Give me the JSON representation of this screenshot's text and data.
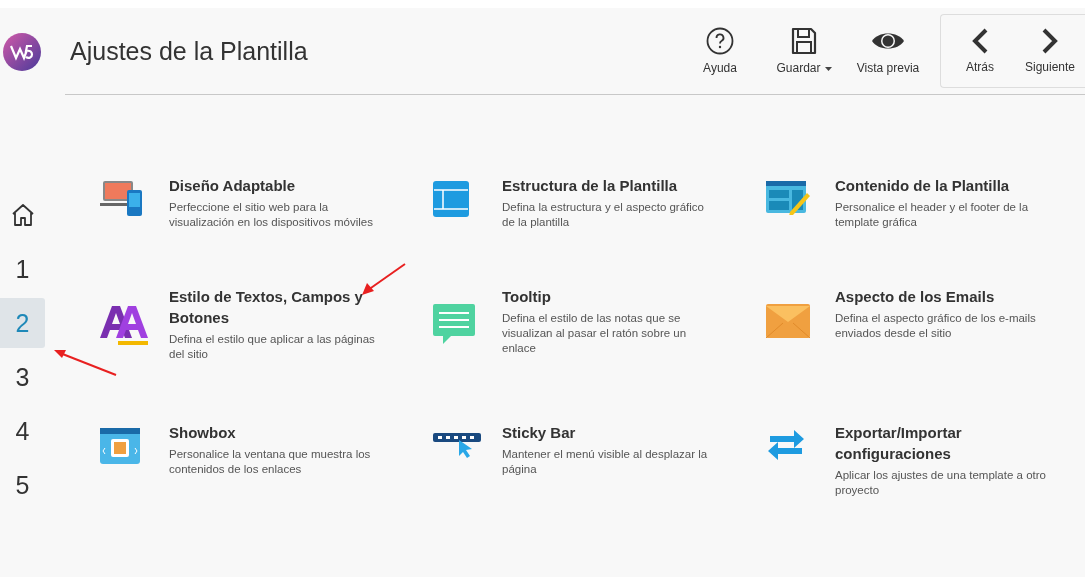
{
  "window": {
    "title": "Ajustes de la Plantilla"
  },
  "sidebar": {
    "items": [
      {
        "kind": "home",
        "selected": false
      },
      {
        "kind": "step",
        "label": "1",
        "selected": false
      },
      {
        "kind": "step",
        "label": "2",
        "selected": true
      },
      {
        "kind": "step",
        "label": "3",
        "selected": false
      },
      {
        "kind": "step",
        "label": "4",
        "selected": false
      },
      {
        "kind": "step",
        "label": "5",
        "selected": false
      }
    ]
  },
  "toolbar": {
    "buttons": [
      {
        "label": "Ayuda",
        "dropdown": false
      },
      {
        "label": "Guardar",
        "dropdown": true
      },
      {
        "label": "Vista previa",
        "dropdown": false
      }
    ],
    "nav": [
      {
        "label": "Atrás"
      },
      {
        "label": "Siguiente"
      }
    ]
  },
  "options": [
    {
      "title": "Diseño Adaptable",
      "description": "Perfeccione el sitio web para la visualización en los dispositivos móviles"
    },
    {
      "title": "Estructura de la Plantilla",
      "description": "Defina la estructura y el aspecto gráfico de la plantilla"
    },
    {
      "title": "Contenido de la Plantilla",
      "description": "Personalice el header y el footer de la template gráfica"
    },
    {
      "title": "Estilo de Textos, Campos y Botones",
      "description": "Defina el estilo que aplicar a las páginas del sitio"
    },
    {
      "title": "Tooltip",
      "description": "Defina el estilo de las notas que se visualizan al pasar el ratón sobre un enlace"
    },
    {
      "title": "Aspecto de los Emails",
      "description": "Defina el aspecto gráfico de los e-mails enviados desde el sitio"
    },
    {
      "title": "Showbox",
      "description": "Personalice la ventana que muestra los contenidos de los enlaces"
    },
    {
      "title": "Sticky Bar",
      "description": "Mantener el menú visible al desplazar la página"
    },
    {
      "title": "Exportar/Importar configuraciones",
      "description": "Aplicar los ajustes de una template a otro proyecto"
    }
  ]
}
